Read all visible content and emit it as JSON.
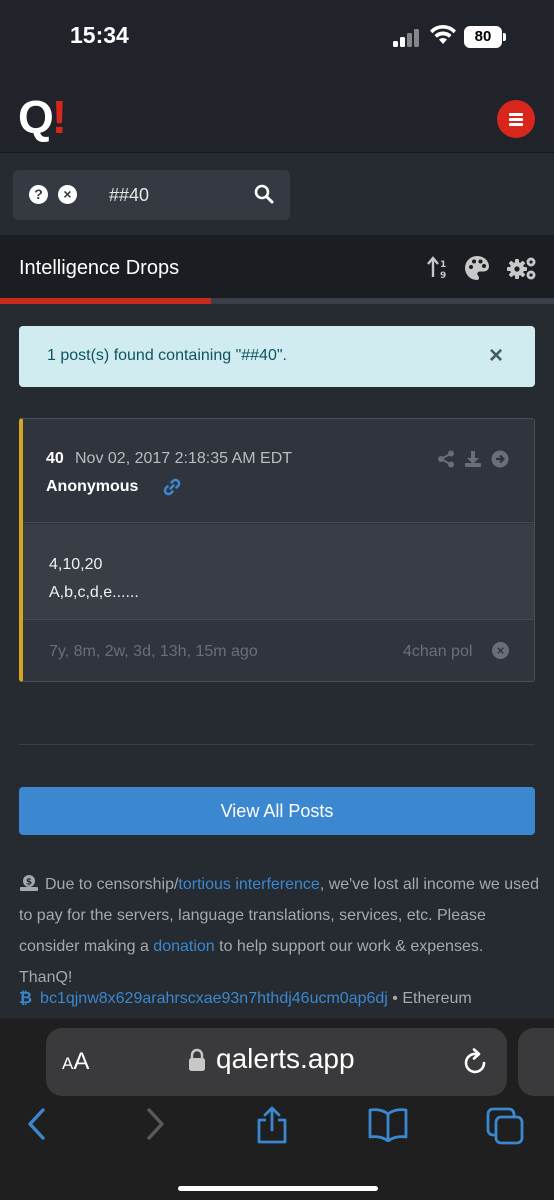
{
  "status_bar": {
    "time": "15:34",
    "battery": "80"
  },
  "header": {
    "logo_letter": "Q",
    "logo_bang": "!"
  },
  "search": {
    "value": "##40",
    "help_glyph": "?",
    "clear_glyph": "×"
  },
  "title_bar": {
    "title": "Intelligence Drops",
    "progress_fraction": 0.38
  },
  "alert": {
    "text": "1 post(s) found containing \"##40\".",
    "close_glyph": "×"
  },
  "post": {
    "number": "40",
    "date": "Nov 02, 2017 2:18:35 AM EDT",
    "author": "Anonymous",
    "lines": [
      "4,10,20",
      "A,b,c,d,e......"
    ],
    "ago": "7y, 8m, 2w, 3d, 13h, 15m ago",
    "source": "4chan pol",
    "accent_color": "#d4a422"
  },
  "view_all_label": "View All Posts",
  "donation": {
    "part1": "Due to censorship/",
    "link1": "tortious interference",
    "part2": ", we've lost all income we used to pay for the servers, language translations, services, etc. Please consider making a ",
    "link2": "donation",
    "part3": " to help support our work & expenses. ThanQ!",
    "btc_glyph": "₿",
    "btc_address": "bc1qjnw8x629arahrscxae93n7hthdj46ucm0ap6dj",
    "after_btc": " • Ethereum"
  },
  "browser": {
    "aa_small": "A",
    "aa_large": "A",
    "url": "qalerts.app"
  },
  "colors": {
    "accent_red": "#d9261c",
    "link_blue": "#3b88d0",
    "alert_bg": "#d1ecf1"
  }
}
